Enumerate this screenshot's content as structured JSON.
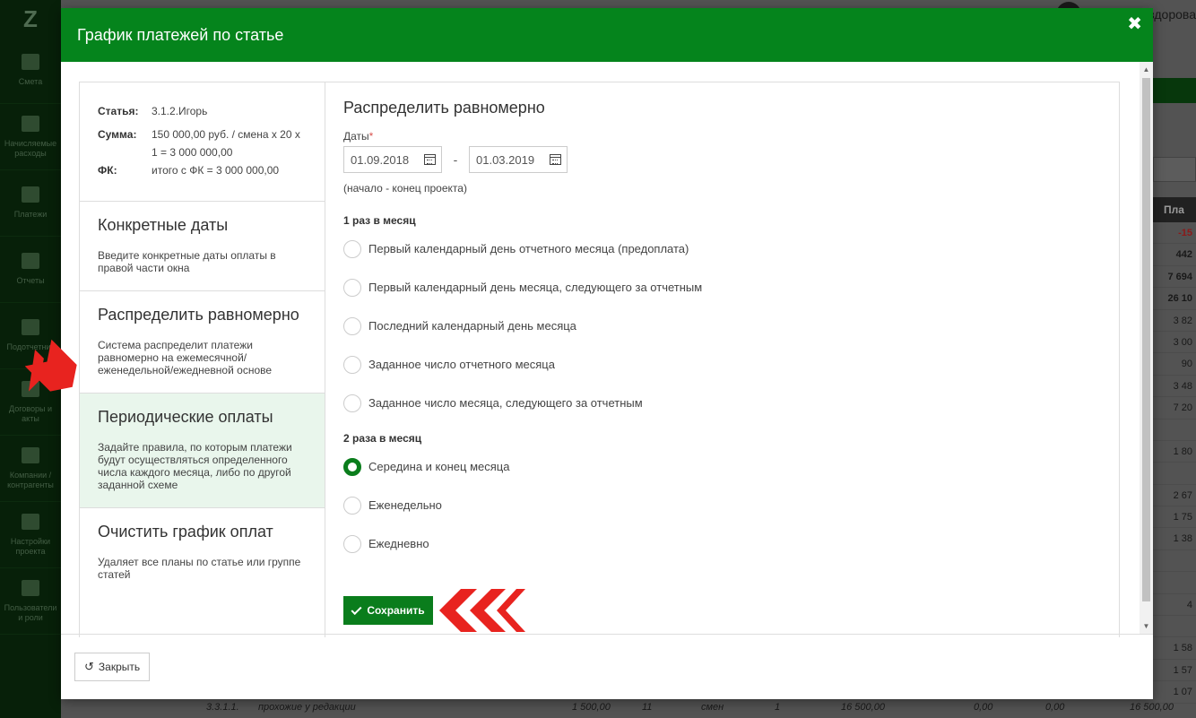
{
  "app": {
    "logo": "Z",
    "user_name_partial": "здорова",
    "nav": [
      {
        "label": "Смета",
        "icon": "book-icon"
      },
      {
        "label": "Начисляемые расходы",
        "icon": "calendar-icon"
      },
      {
        "label": "Платежи",
        "icon": "wallet-icon"
      },
      {
        "label": "Отчеты",
        "icon": "chart-icon"
      },
      {
        "label": "Подотчетник",
        "icon": "briefcase-icon"
      },
      {
        "label": "Договоры и акты",
        "icon": "list-icon"
      },
      {
        "label": "Компании / контрагенты",
        "icon": "person-icon"
      },
      {
        "label": "Настройки проекта",
        "icon": "sliders-icon"
      },
      {
        "label": "Пользователи и роли",
        "icon": "users-icon"
      }
    ],
    "table_header_partial": "Пла",
    "table_values_partial": [
      "-15",
      "442",
      "7 694",
      "26 10",
      "3 82",
      "3 00",
      "90",
      "3 48",
      "7 20",
      "",
      "1 80",
      "",
      "2 67",
      "1 75",
      "1 38",
      "",
      "",
      "4",
      "",
      "1 58",
      "1 57",
      "1 07"
    ],
    "bottom_row": [
      "3.3.1.1.",
      "прохожие у редакции",
      "1 500,00",
      "11",
      "смен",
      "1",
      "16 500,00",
      "0,00",
      "0,00",
      "16 500,00"
    ]
  },
  "modal": {
    "title": "График платежей по статье",
    "close_symbol": "✖",
    "info": {
      "article_label": "Статья:",
      "article_value": "3.1.2.Игорь",
      "sum_label": "Сумма:",
      "sum_value": "150 000,00 руб. / смена x 20 x 1 = 3 000 000,00",
      "fk_label": "ФК:",
      "fk_value": "итого с ФК = 3 000 000,00"
    },
    "options": [
      {
        "title": "Конкретные даты",
        "desc": "Введите конкретные даты оплаты в правой части окна",
        "active": false
      },
      {
        "title": "Распределить равномерно",
        "desc": "Система распределит платежи равномерно на ежемесячной/ еженедельной/ежедневной основе",
        "active": false
      },
      {
        "title": "Периодические оплаты",
        "desc": "Задайте правила, по которым платежи будут осуществляться определенного числа каждого месяца, либо по другой заданной схеме",
        "active": true
      },
      {
        "title": "Очистить график оплат",
        "desc": "Удаляет все планы по статье или группе статей",
        "active": false
      }
    ],
    "form": {
      "section_title": "Распределить равномерно",
      "dates_label": "Даты",
      "required_mark": "*",
      "date_from": "01.09.2018",
      "date_separator": "-",
      "date_to": "01.03.2019",
      "dates_hint": "(начало - конец проекта)",
      "group1_title": "1 раз в месяц",
      "group1": [
        {
          "label": "Первый календарный день отчетного месяца (предоплата)",
          "checked": false
        },
        {
          "label": "Первый календарный день месяца, следующего за отчетным",
          "checked": false
        },
        {
          "label": "Последний календарный день месяца",
          "checked": false
        },
        {
          "label": "Заданное число отчетного месяца",
          "checked": false
        },
        {
          "label": "Заданное число месяца, следующего за отчетным",
          "checked": false
        }
      ],
      "group2_title": "2 раза в месяц",
      "group2": [
        {
          "label": "Середина и конец месяца",
          "checked": true
        },
        {
          "label": "Еженедельно",
          "checked": false
        },
        {
          "label": "Ежедневно",
          "checked": false
        }
      ],
      "save_label": "Сохранить"
    },
    "footer": {
      "close_label": "Закрыть"
    }
  },
  "colors": {
    "header_green": "#05841c",
    "button_green": "#0a7d1c",
    "active_option_bg": "#e9f6ec",
    "marker_red": "#e8231f"
  }
}
